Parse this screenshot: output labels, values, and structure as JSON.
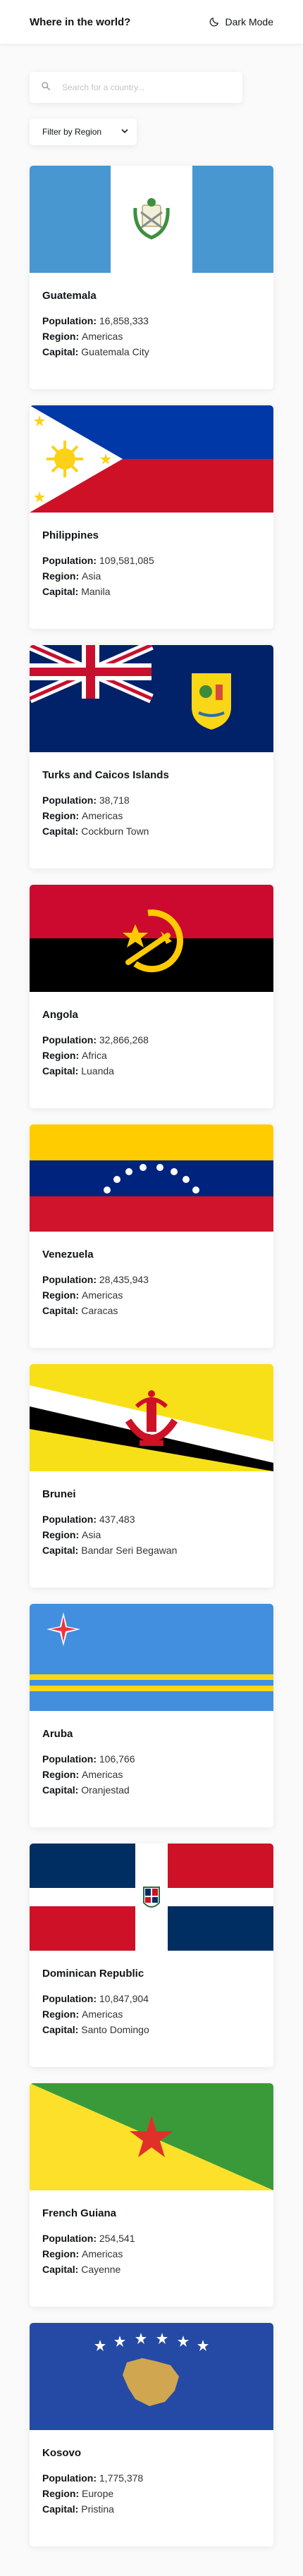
{
  "header": {
    "title": "Where in the world?",
    "mode_label": "Dark Mode"
  },
  "search": {
    "placeholder": "Search for a country...",
    "value": ""
  },
  "filter": {
    "selected": "Filter by Region"
  },
  "labels": {
    "population": "Population:",
    "region": "Region:",
    "capital": "Capital:"
  },
  "countries": [
    {
      "name": "Guatemala",
      "population": "16,858,333",
      "region": "Americas",
      "capital": "Guatemala City"
    },
    {
      "name": "Philippines",
      "population": "109,581,085",
      "region": "Asia",
      "capital": "Manila"
    },
    {
      "name": "Turks and Caicos Islands",
      "population": "38,718",
      "region": "Americas",
      "capital": "Cockburn Town"
    },
    {
      "name": "Angola",
      "population": "32,866,268",
      "region": "Africa",
      "capital": "Luanda"
    },
    {
      "name": "Venezuela",
      "population": "28,435,943",
      "region": "Americas",
      "capital": "Caracas"
    },
    {
      "name": "Brunei",
      "population": "437,483",
      "region": "Asia",
      "capital": "Bandar Seri Begawan"
    },
    {
      "name": "Aruba",
      "population": "106,766",
      "region": "Americas",
      "capital": "Oranjestad"
    },
    {
      "name": "Dominican Republic",
      "population": "10,847,904",
      "region": "Americas",
      "capital": "Santo Domingo"
    },
    {
      "name": "French Guiana",
      "population": "254,541",
      "region": "Americas",
      "capital": "Cayenne"
    },
    {
      "name": "Kosovo",
      "population": "1,775,378",
      "region": "Europe",
      "capital": "Pristina"
    }
  ],
  "colors": {
    "background": "#fafafa",
    "card": "#ffffff",
    "text": "#111517"
  }
}
